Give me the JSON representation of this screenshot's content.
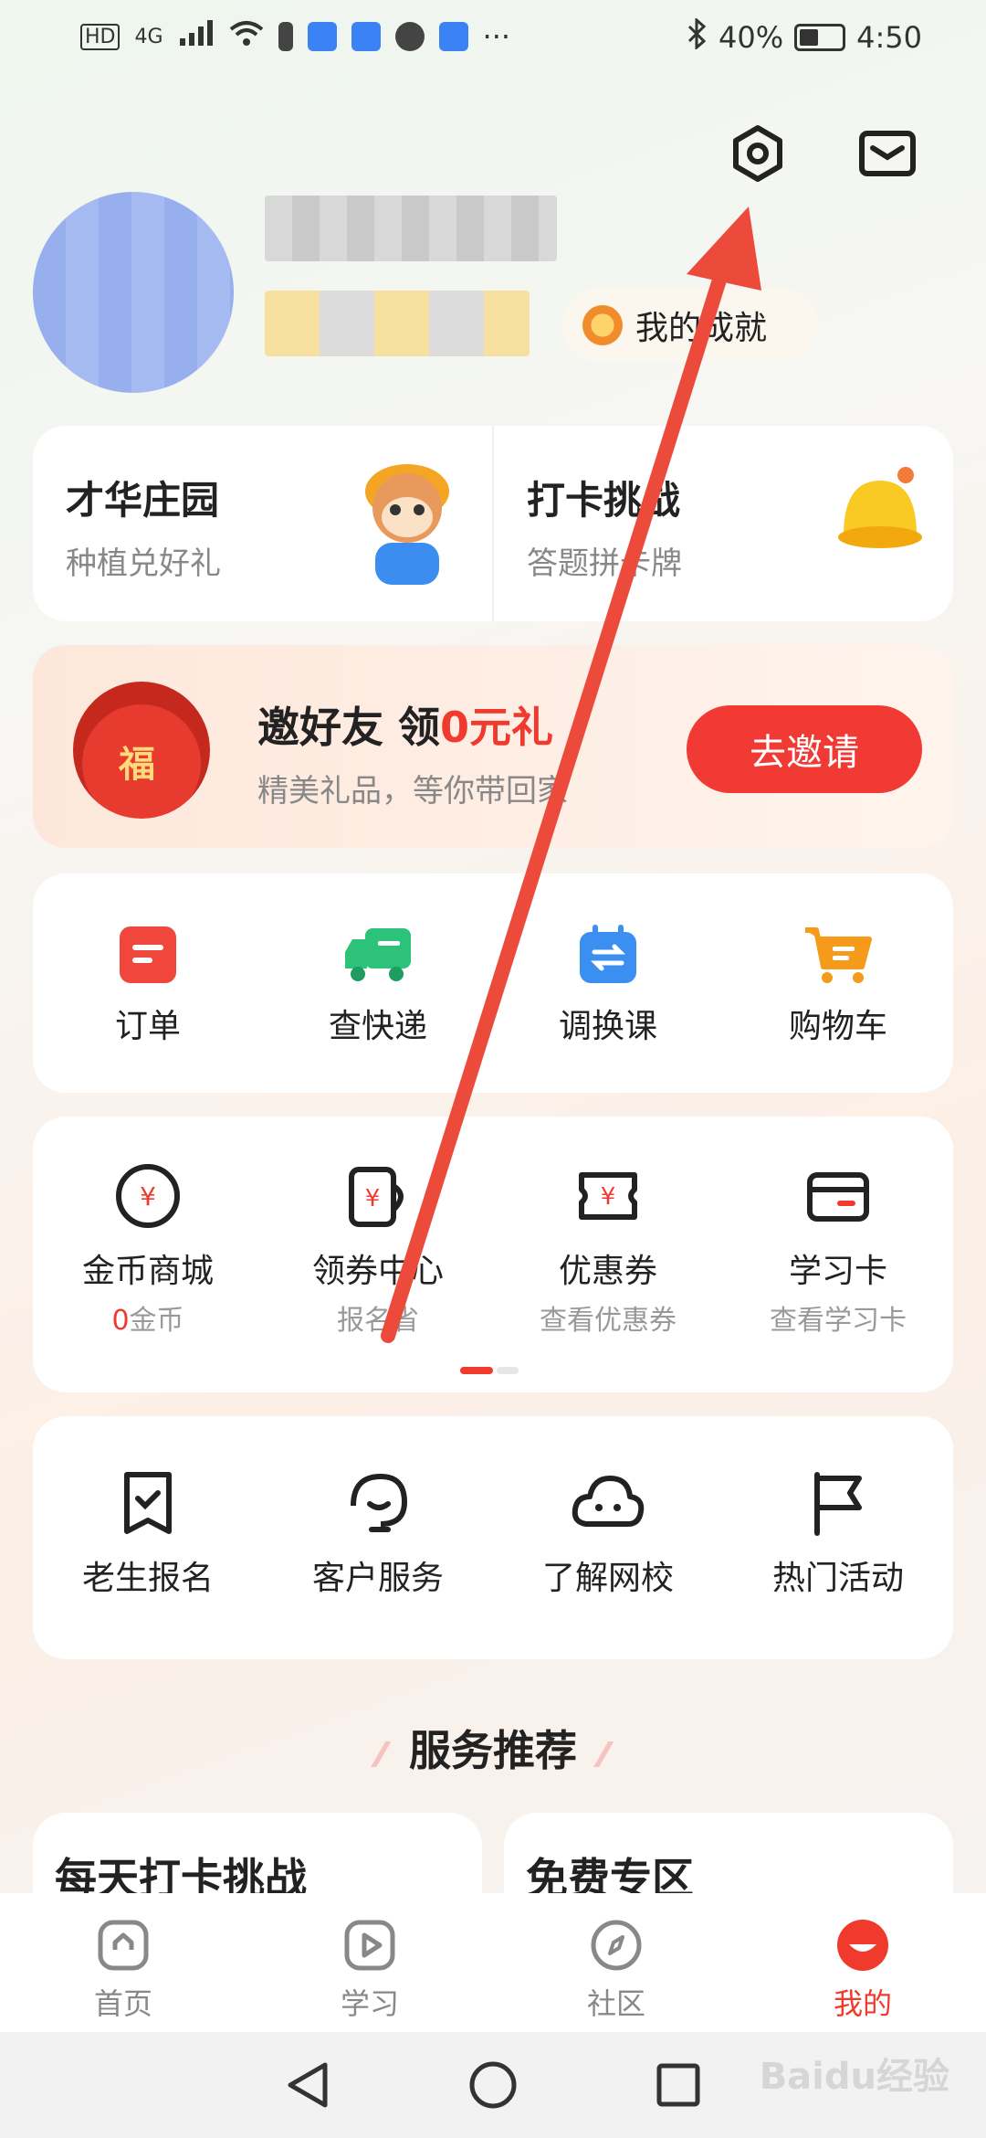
{
  "status_bar": {
    "left_text": "HD",
    "network": "4G",
    "more": "···",
    "battery": "40%",
    "time": "4:50"
  },
  "header": {
    "settings_icon": "hexagon-settings-icon",
    "mail_icon": "envelope-icon"
  },
  "profile": {
    "achievement_label": "我的成就"
  },
  "feature_cards": [
    {
      "title": "才华庄园",
      "subtitle": "种植兑好礼"
    },
    {
      "title": "打卡挑战",
      "subtitle": "答题拼卡牌"
    }
  ],
  "invite": {
    "title_prefix": "邀好友 领",
    "title_highlight": "0元礼",
    "subtitle": "精美礼品，等你带回家",
    "button": "去邀请",
    "bag_char": "福"
  },
  "row1": [
    {
      "label": "订单",
      "color": "#f0463c"
    },
    {
      "label": "查快递",
      "color": "#2cc27a"
    },
    {
      "label": "调换课",
      "color": "#3a8ff0"
    },
    {
      "label": "购物车",
      "color": "#f59a1b"
    }
  ],
  "row2": [
    {
      "label": "金币商城",
      "count": "0",
      "sub": "金币"
    },
    {
      "label": "领券中心",
      "sub": "报名省"
    },
    {
      "label": "优惠券",
      "sub": "查看优惠券"
    },
    {
      "label": "学习卡",
      "sub": "查看学习卡"
    }
  ],
  "row3": [
    {
      "label": "老生报名"
    },
    {
      "label": "客户服务"
    },
    {
      "label": "了解网校"
    },
    {
      "label": "热门活动"
    }
  ],
  "section": {
    "title": "服务推荐"
  },
  "recommend": [
    {
      "title": "每天打卡挑战"
    },
    {
      "title": "免费专区"
    }
  ],
  "tabs": [
    {
      "label": "首页"
    },
    {
      "label": "学习"
    },
    {
      "label": "社区"
    },
    {
      "label": "我的"
    }
  ],
  "watermark": "Baidu经验",
  "accent": "#f03a2e"
}
